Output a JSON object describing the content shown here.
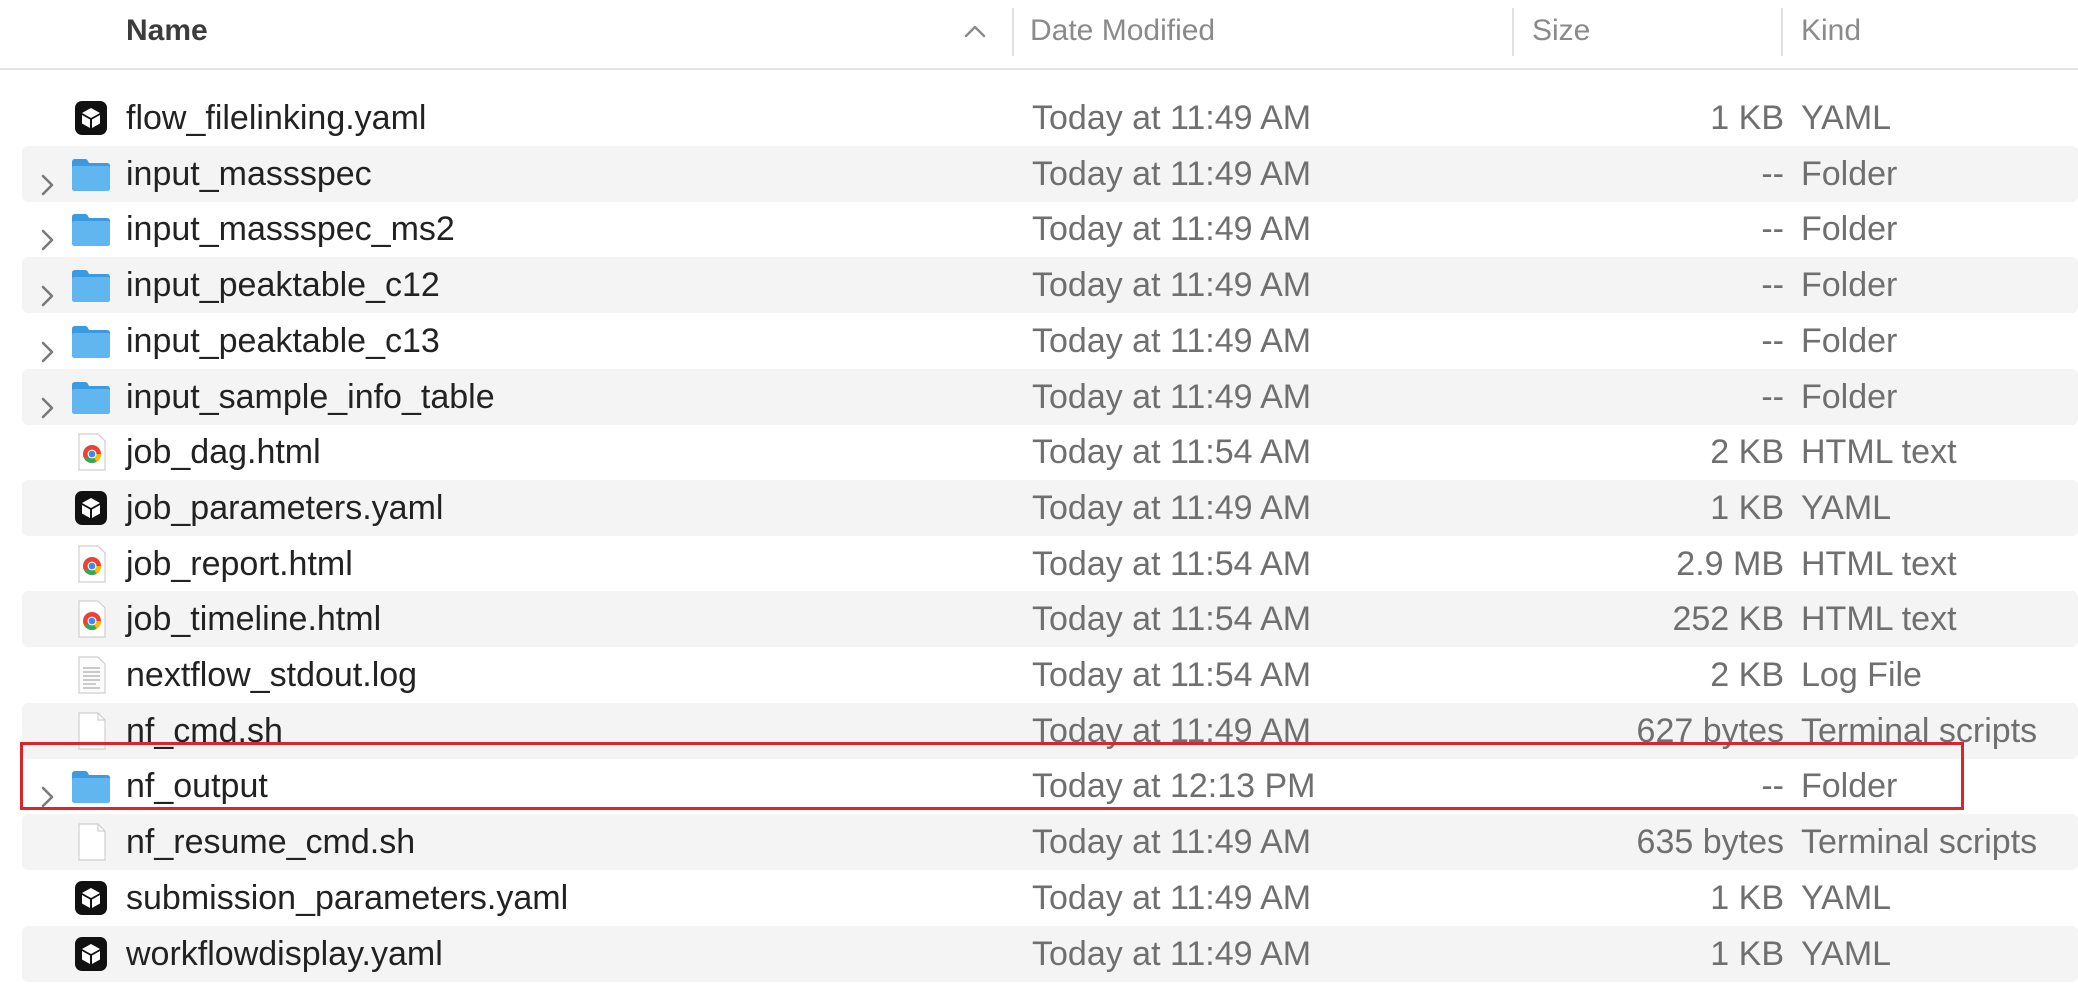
{
  "columns": {
    "name": "Name",
    "date_modified": "Date Modified",
    "size": "Size",
    "kind": "Kind"
  },
  "sort": {
    "column": "name",
    "direction": "ascending",
    "icon": "chevron-up-icon"
  },
  "colors": {
    "highlight": "#d9262c",
    "folder": "#4aa8ec",
    "row_alt": "#f4f4f4"
  },
  "files": [
    {
      "name": "flow_filelinking.yaml",
      "date": "Today at 11:49 AM",
      "size": "1 KB",
      "kind": "YAML",
      "icon": "yaml-icon",
      "expandable": false
    },
    {
      "name": "input_massspec",
      "date": "Today at 11:49 AM",
      "size": "--",
      "kind": "Folder",
      "icon": "folder-icon",
      "expandable": true
    },
    {
      "name": "input_massspec_ms2",
      "date": "Today at 11:49 AM",
      "size": "--",
      "kind": "Folder",
      "icon": "folder-icon",
      "expandable": true
    },
    {
      "name": "input_peaktable_c12",
      "date": "Today at 11:49 AM",
      "size": "--",
      "kind": "Folder",
      "icon": "folder-icon",
      "expandable": true
    },
    {
      "name": "input_peaktable_c13",
      "date": "Today at 11:49 AM",
      "size": "--",
      "kind": "Folder",
      "icon": "folder-icon",
      "expandable": true
    },
    {
      "name": "input_sample_info_table",
      "date": "Today at 11:49 AM",
      "size": "--",
      "kind": "Folder",
      "icon": "folder-icon",
      "expandable": true
    },
    {
      "name": "job_dag.html",
      "date": "Today at 11:54 AM",
      "size": "2 KB",
      "kind": "HTML text",
      "icon": "chrome-html-icon",
      "expandable": false
    },
    {
      "name": "job_parameters.yaml",
      "date": "Today at 11:49 AM",
      "size": "1 KB",
      "kind": "YAML",
      "icon": "yaml-icon",
      "expandable": false
    },
    {
      "name": "job_report.html",
      "date": "Today at 11:54 AM",
      "size": "2.9 MB",
      "kind": "HTML text",
      "icon": "chrome-html-icon",
      "expandable": false
    },
    {
      "name": "job_timeline.html",
      "date": "Today at 11:54 AM",
      "size": "252 KB",
      "kind": "HTML text",
      "icon": "chrome-html-icon",
      "expandable": false
    },
    {
      "name": "nextflow_stdout.log",
      "date": "Today at 11:54 AM",
      "size": "2 KB",
      "kind": "Log File",
      "icon": "log-file-icon",
      "expandable": false
    },
    {
      "name": "nf_cmd.sh",
      "date": "Today at 11:49 AM",
      "size": "627 bytes",
      "kind": "Terminal scripts",
      "icon": "blank-document-icon",
      "expandable": false
    },
    {
      "name": "nf_output",
      "date": "Today at 12:13 PM",
      "size": "--",
      "kind": "Folder",
      "icon": "folder-icon",
      "expandable": true,
      "highlighted": true
    },
    {
      "name": "nf_resume_cmd.sh",
      "date": "Today at 11:49 AM",
      "size": "635 bytes",
      "kind": "Terminal scripts",
      "icon": "blank-document-icon",
      "expandable": false
    },
    {
      "name": "submission_parameters.yaml",
      "date": "Today at 11:49 AM",
      "size": "1 KB",
      "kind": "YAML",
      "icon": "yaml-icon",
      "expandable": false
    },
    {
      "name": "workflowdisplay.yaml",
      "date": "Today at 11:49 AM",
      "size": "1 KB",
      "kind": "YAML",
      "icon": "yaml-icon",
      "expandable": false
    }
  ]
}
